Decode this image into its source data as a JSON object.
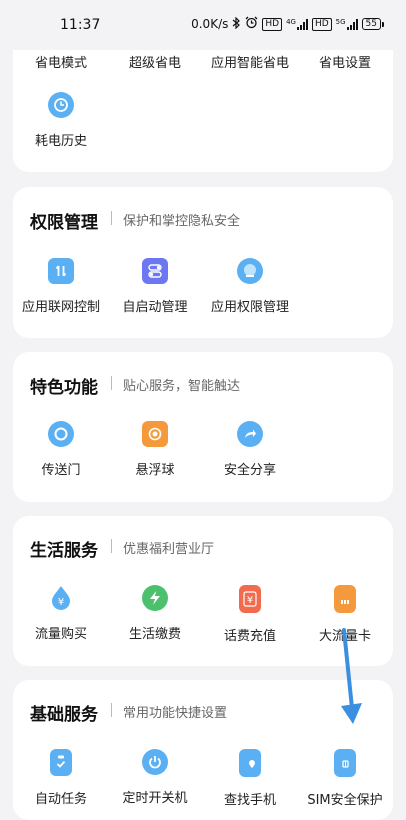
{
  "status_bar": {
    "time": "11:37",
    "net_speed": "0.0K/s",
    "hd1": "HD",
    "net1": "4G",
    "hd2": "HD",
    "net2": "5G",
    "battery": "55"
  },
  "power_card": {
    "top_labels": [
      "省电模式",
      "超级省电",
      "应用智能省电",
      "省电设置"
    ],
    "items": [
      {
        "label": "耗电历史",
        "icon": "clock-icon",
        "color": "#5ab0f2"
      }
    ]
  },
  "permissions_card": {
    "title": "权限管理",
    "subtitle": "保护和掌控隐私安全",
    "items": [
      {
        "label": "应用联网控制",
        "icon": "network-control-icon",
        "color": "#5ab0f2"
      },
      {
        "label": "自启动管理",
        "icon": "autostart-toggle-icon",
        "color": "#6c78f2"
      },
      {
        "label": "应用权限管理",
        "icon": "permission-icon",
        "color": "#5ab0f2"
      }
    ]
  },
  "features_card": {
    "title": "特色功能",
    "subtitle": "贴心服务，智能触达",
    "items": [
      {
        "label": "传送门",
        "icon": "portal-icon",
        "color": "#5ab0f2"
      },
      {
        "label": "悬浮球",
        "icon": "floating-ball-icon",
        "color": "#f59a3c"
      },
      {
        "label": "安全分享",
        "icon": "share-icon",
        "color": "#5ab0f2"
      }
    ]
  },
  "life_card": {
    "title": "生活服务",
    "subtitle": "优惠福利营业厅",
    "items": [
      {
        "label": "流量购买",
        "icon": "data-drop-icon",
        "color": "#5ab0f2"
      },
      {
        "label": "生活缴费",
        "icon": "bolt-icon",
        "color": "#4cc16d"
      },
      {
        "label": "话费充值",
        "icon": "yuan-phone-icon",
        "color": "#f26b4f"
      },
      {
        "label": "大流量卡",
        "icon": "sim-card-icon",
        "color": "#f59a3c"
      }
    ]
  },
  "basic_card": {
    "title": "基础服务",
    "subtitle": "常用功能快捷设置",
    "items": [
      {
        "label": "自动任务",
        "icon": "clipboard-check-icon",
        "color": "#5ab0f2"
      },
      {
        "label": "定时开关机",
        "icon": "power-icon",
        "color": "#5ab0f2"
      },
      {
        "label": "查找手机",
        "icon": "find-phone-icon",
        "color": "#5ab0f2"
      },
      {
        "label": "SIM安全保护",
        "icon": "sim-protect-icon",
        "color": "#5ab0f2"
      }
    ]
  }
}
